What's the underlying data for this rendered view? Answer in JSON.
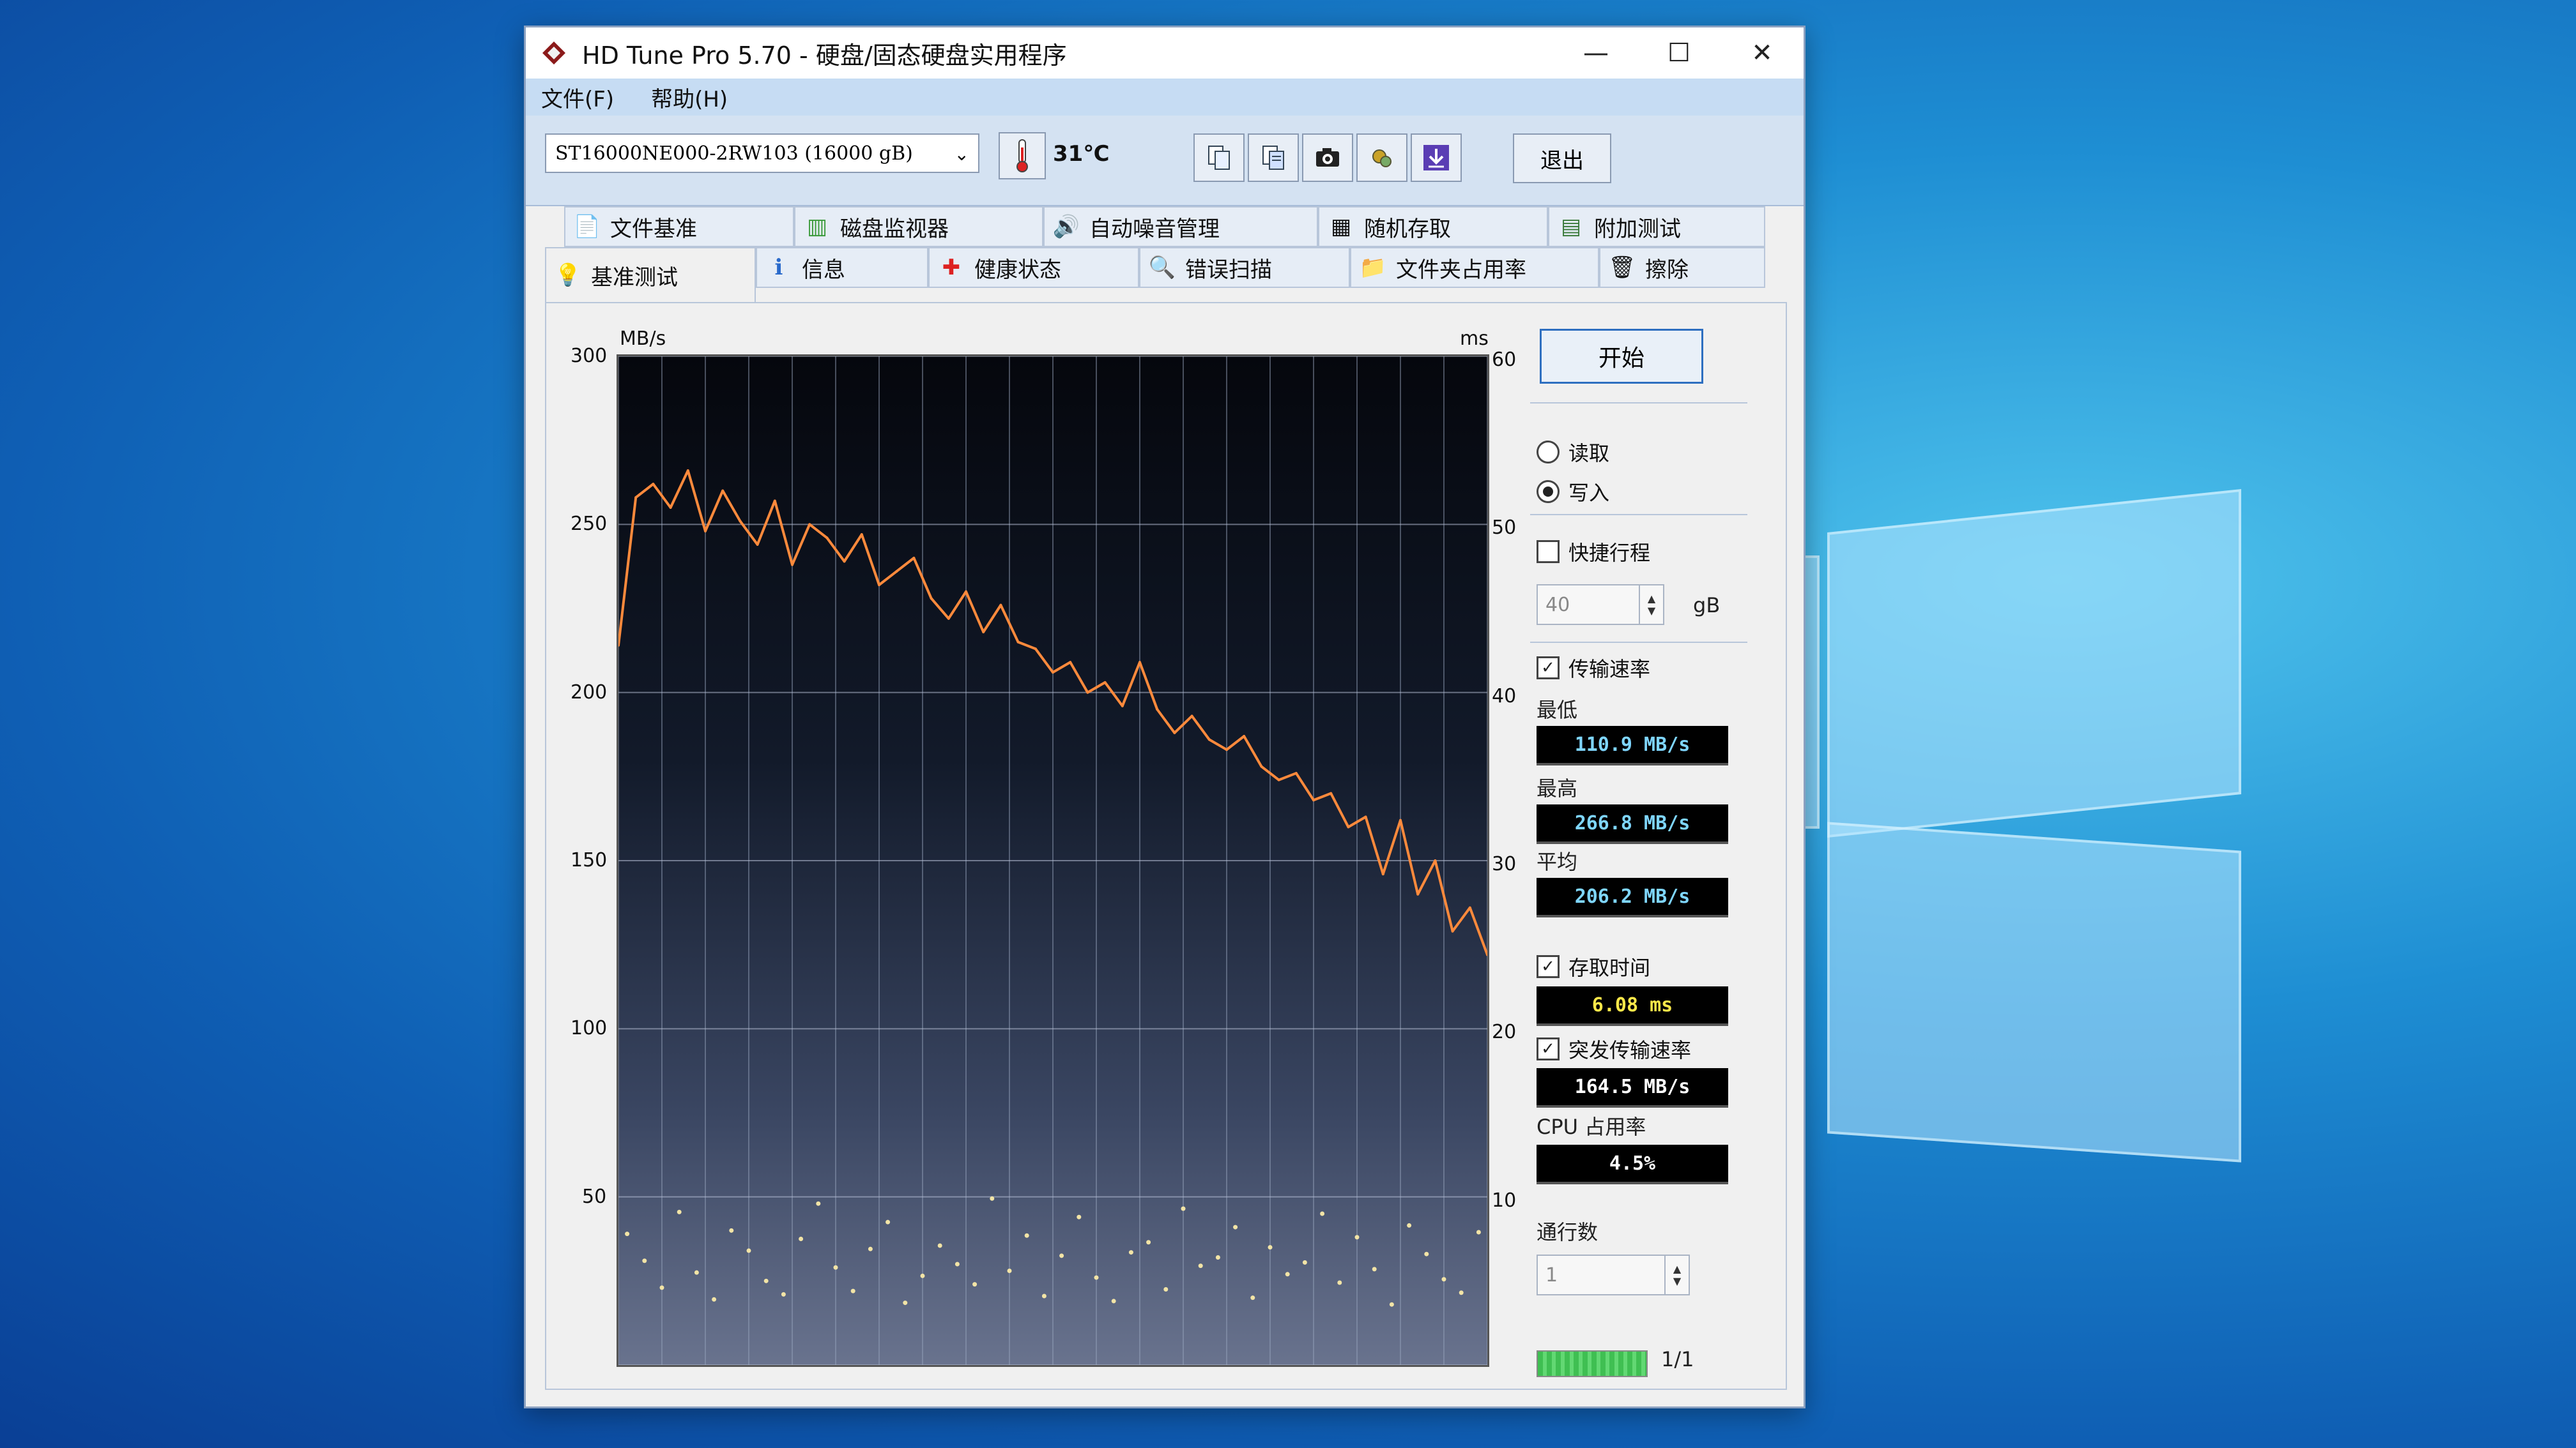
{
  "window": {
    "title": "HD Tune Pro 5.70 - 硬盘/固态硬盘实用程序",
    "menu": [
      "文件(F)",
      "帮助(H)"
    ]
  },
  "toolbar": {
    "drive": "ST16000NE000-2RW103 (16000 gB)",
    "temperature": "31℃",
    "exit_label": "退出"
  },
  "tabs": {
    "row1": [
      "文件基准",
      "磁盘监视器",
      "自动噪音管理",
      "随机存取",
      "附加测试"
    ],
    "row2": [
      "基准测试",
      "信息",
      "健康状态",
      "错误扫描",
      "文件夹占用率",
      "擦除"
    ],
    "active": "基准测试"
  },
  "panel": {
    "start_label": "开始",
    "read_label": "读取",
    "write_label": "写入",
    "mode_selected": "写入",
    "short_stroke_label": "快捷行程",
    "short_stroke_checked": false,
    "short_stroke_value": "40",
    "short_stroke_unit": "gB",
    "transfer_rate_label": "传输速率",
    "transfer_rate_checked": true,
    "min_label": "最低",
    "min_value": "110.9 MB/s",
    "max_label": "最高",
    "max_value": "266.8 MB/s",
    "avg_label": "平均",
    "avg_value": "206.2 MB/s",
    "access_time_label": "存取时间",
    "access_time_checked": true,
    "access_time_value": "6.08 ms",
    "burst_label": "突发传输速率",
    "burst_checked": true,
    "burst_value": "164.5 MB/s",
    "cpu_label": "CPU 占用率",
    "cpu_value": "4.5%",
    "passes_label": "通行数",
    "passes_value": "1",
    "progress_label": "1/1",
    "progress": 1.0
  },
  "colors": {
    "value_cyan": "#7fd6ff",
    "value_yellow": "#ffe94a",
    "value_white": "#ffffff",
    "line_orange": "#ff8a3c",
    "dot_color": "#f2e4a6"
  },
  "chart_data": {
    "type": "line",
    "ylabel": "MB/s",
    "ylabel_right": "ms",
    "ylim": [
      0,
      300
    ],
    "ylim_right": [
      0,
      60
    ],
    "yticks": [
      "300",
      "250",
      "200",
      "150",
      "100",
      "50"
    ],
    "yticks_right": [
      "60",
      "50",
      "40",
      "30",
      "20",
      "10"
    ],
    "grid": true,
    "series": [
      {
        "x": [
          0,
          2,
          4,
          6,
          8,
          10,
          12,
          14,
          16,
          18,
          20,
          22,
          24,
          26,
          28,
          30,
          32,
          34,
          36,
          38,
          40,
          42,
          44,
          46,
          48,
          50,
          52,
          54,
          56,
          58,
          60,
          62,
          64,
          66,
          68,
          70,
          72,
          74,
          76,
          78,
          80,
          82,
          84,
          86,
          88,
          90,
          92,
          94,
          96,
          98,
          100
        ],
        "values": [
          214,
          258,
          262,
          255,
          266,
          248,
          260,
          251,
          244,
          257,
          238,
          250,
          246,
          239,
          247,
          232,
          236,
          240,
          228,
          222,
          230,
          218,
          226,
          215,
          213,
          206,
          209,
          200,
          203,
          196,
          209,
          195,
          188,
          193,
          186,
          183,
          187,
          178,
          174,
          176,
          168,
          170,
          160,
          163,
          146,
          162,
          140,
          150,
          129,
          136,
          122
        ]
      },
      {
        "name": "access_time_ms",
        "type": "scatter",
        "x": [
          1,
          3,
          5,
          7,
          9,
          11,
          13,
          15,
          17,
          19,
          21,
          23,
          25,
          27,
          29,
          31,
          33,
          35,
          37,
          39,
          41,
          43,
          45,
          47,
          49,
          51,
          53,
          55,
          57,
          59,
          61,
          63,
          65,
          67,
          69,
          71,
          73,
          75,
          77,
          79,
          81,
          83,
          85,
          87,
          89,
          91,
          93,
          95,
          97,
          99
        ],
        "values": [
          7.8,
          6.2,
          4.6,
          9.1,
          5.5,
          3.9,
          8.0,
          6.8,
          5.0,
          4.2,
          7.5,
          9.6,
          5.8,
          4.4,
          6.9,
          8.5,
          3.7,
          5.3,
          7.1,
          6.0,
          4.8,
          9.9,
          5.6,
          7.7,
          4.1,
          6.5,
          8.8,
          5.2,
          3.8,
          6.7,
          7.3,
          4.5,
          9.3,
          5.9,
          6.4,
          8.2,
          4.0,
          7.0,
          5.4,
          6.1,
          9.0,
          4.9,
          7.6,
          5.7,
          3.6,
          8.3,
          6.6,
          5.1,
          4.3,
          7.9
        ]
      }
    ]
  }
}
